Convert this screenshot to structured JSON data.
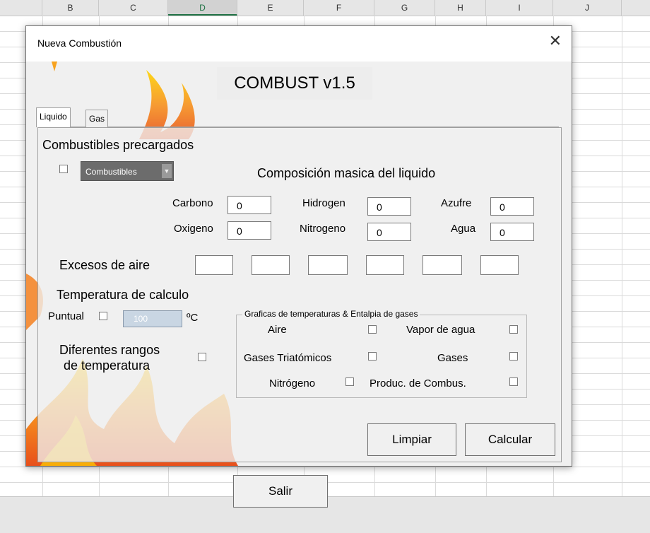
{
  "sheet": {
    "columns": [
      "B",
      "C",
      "D",
      "E",
      "F",
      "G",
      "H",
      "I",
      "J"
    ],
    "selected_column": "D"
  },
  "dialog": {
    "title": "Nueva Combustión",
    "close_glyph": "✕",
    "app_title": "COMBUST  v1.5",
    "tabs": [
      "Liquido",
      "Gas"
    ],
    "active_tab": "Liquido",
    "precargados": {
      "heading": "Combustibles precargados",
      "combo_value": "Combustibles"
    },
    "composition": {
      "heading": "Composición masica del liquido",
      "fields": [
        {
          "label": "Carbono",
          "value": "0"
        },
        {
          "label": "Hidrogen",
          "value": "0"
        },
        {
          "label": "Azufre",
          "value": "0"
        },
        {
          "label": "Oxigeno",
          "value": "0"
        },
        {
          "label": "Nitrogeno",
          "value": "0"
        },
        {
          "label": "Agua",
          "value": "0"
        }
      ]
    },
    "excess": {
      "label": "Excesos de aire",
      "values": [
        "",
        "",
        "",
        "",
        "",
        ""
      ]
    },
    "temperature": {
      "heading": "Temperatura de calculo",
      "puntual_label": "Puntual",
      "puntual_value": "100",
      "unit": "ºC",
      "ranges_line1": "Diferentes rangos",
      "ranges_line2": "de temperatura"
    },
    "graphs": {
      "caption": "Graficas de temperaturas & Entalpia de gases",
      "items": [
        "Aire",
        "Vapor de agua",
        "Gases Triatómicos",
        "Gases",
        "Nitrógeno",
        "Produc. de Combus."
      ]
    },
    "buttons": {
      "clear": "Limpiar",
      "calculate": "Calcular",
      "exit": "Salir"
    }
  },
  "colors": {
    "flame_orange": "#f47a20",
    "flame_yellow": "#ffd400",
    "excel_green": "#217346"
  }
}
